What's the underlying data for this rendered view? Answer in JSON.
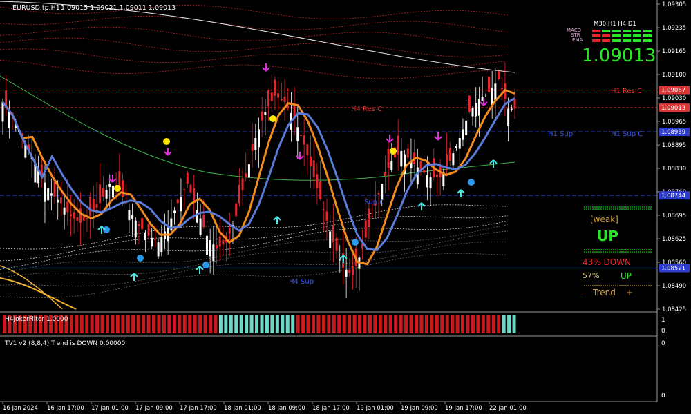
{
  "chart_header": {
    "symbol": "EURUSD.tp,H1",
    "ohlc": "1.09015 1.09021 1.09011 1.09013"
  },
  "price_axis": {
    "ticks": [
      "1.09305",
      "1.09235",
      "1.09165",
      "1.09100",
      "1.09030",
      "1.08965",
      "1.08895",
      "1.08830",
      "1.08760",
      "1.08695",
      "1.08625",
      "1.08560",
      "1.08490",
      "1.08425"
    ],
    "price_box_labels": [
      "1.09067",
      "1.09013",
      "1.08939",
      "1.08744",
      "1.08521"
    ]
  },
  "time_axis": {
    "labels": [
      "16 Jan 2024",
      "16 Jan 17:00",
      "17 Jan 01:00",
      "17 Jan 09:00",
      "17 Jan 17:00",
      "18 Jan 01:00",
      "18 Jan 09:00",
      "18 Jan 17:00",
      "19 Jan 01:00",
      "19 Jan 09:00",
      "19 Jan 17:00",
      "22 Jan 01:00"
    ]
  },
  "level_labels": {
    "h4_res": "H4 Res C",
    "h1_res": "H1 Res C",
    "h1_sup": "H1 Sup",
    "h1_sup_c": "H1 Sup C",
    "h4_sup": "H4 Sup",
    "sup_c": "Sup C"
  },
  "dashboard": {
    "timeframes": "M30 H1 H4 D1",
    "row_labels": [
      "MACD",
      "STR",
      "EMA"
    ],
    "big_price": "1.09013",
    "weak_label": "[weak]",
    "up_big": "UP",
    "pct_down": "43% DOWN",
    "pct_up_prefix": "57%",
    "up_small": "UP",
    "trend_minus": "-",
    "trend_label": "Trend",
    "trend_plus": "+"
  },
  "subwindow1": {
    "title": "H4JokerFilter 1.0000",
    "axis_ticks": [
      "1",
      "0"
    ]
  },
  "subwindow2": {
    "title": "TV1 v2 (8,8,4) Trend is DOWN 0.00000",
    "axis_ticks": [
      "0",
      "0"
    ]
  },
  "colors": {
    "background": "#000000",
    "bull_candle": "#ffffff",
    "bear_candle": "#e8252b",
    "fast_line": "#f28c1e",
    "slow_line": "#5a7bd8",
    "cyan_zone": "#25c4f0",
    "pink_zone": "#f77ce8",
    "yellow_zone": "#ffd21c",
    "resistance_line": "#d93636",
    "support_line": "#2e3fd0",
    "filter_red": "#c8191e",
    "filter_teal": "#6ed6c6"
  },
  "chart_data": {
    "type": "candlestick",
    "symbol": "EURUSD",
    "timeframe": "H1",
    "ylim": [
      1.08395,
      1.09335
    ],
    "levels": {
      "H1 Res C": 1.09067,
      "current": 1.09013,
      "H1 Sup C": 1.08939,
      "Sup C": 1.08744,
      "H4 Sup": 1.08521
    },
    "close_series_approx": [
      1.0903,
      1.0899,
      1.0892,
      1.0886,
      1.088,
      1.0875,
      1.0872,
      1.0868,
      1.0866,
      1.0868,
      1.0872,
      1.0878,
      1.0876,
      1.087,
      1.0865,
      1.0862,
      1.086,
      1.0865,
      1.0872,
      1.0878,
      1.087,
      1.0862,
      1.0858,
      1.086,
      1.0868,
      1.088,
      1.0892,
      1.09,
      1.0905,
      1.0903,
      1.0898,
      1.089,
      1.088,
      1.087,
      1.086,
      1.0852,
      1.085,
      1.0858,
      1.0868,
      1.0878,
      1.0885,
      1.0888,
      1.0885,
      1.0882,
      1.088,
      1.088,
      1.0885,
      1.0892,
      1.09,
      1.0904,
      1.0906,
      1.091,
      1.0901
    ],
    "filter_histogram": {
      "red_then_teal_then_red_then_teal": [
        "red",
        "teal",
        "red",
        "teal"
      ]
    },
    "dashboard_timeframes": [
      "M30",
      "H1",
      "H4",
      "D1"
    ],
    "dashboard_signals": "UP",
    "dashboard_strength": "weak",
    "trend_percent_down": 43,
    "trend_percent_up": 57
  }
}
